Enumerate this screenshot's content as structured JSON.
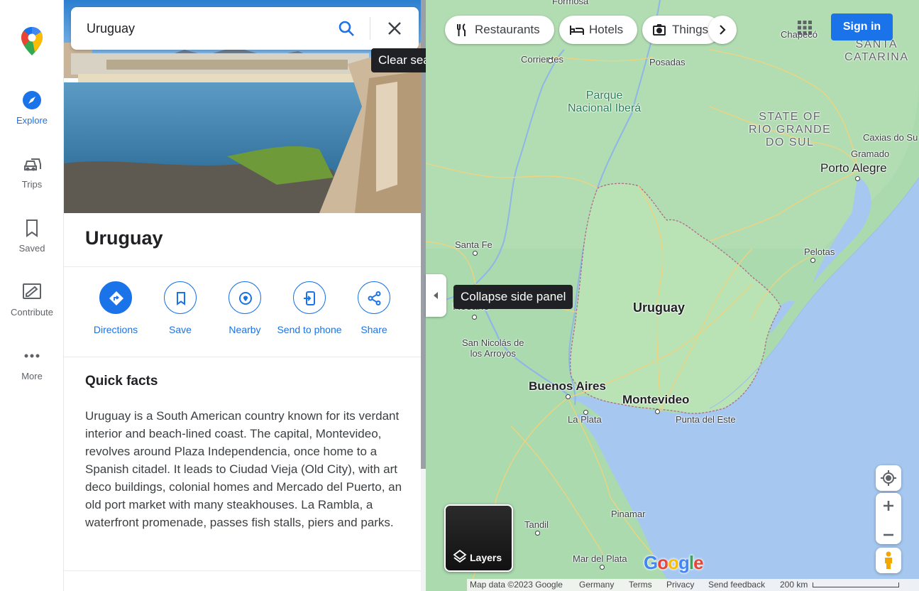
{
  "rail": {
    "items": [
      {
        "label": "Explore",
        "icon": "compass-icon"
      },
      {
        "label": "Trips",
        "icon": "car-icon"
      },
      {
        "label": "Saved",
        "icon": "bookmark-icon"
      },
      {
        "label": "Contribute",
        "icon": "edit-icon"
      },
      {
        "label": "More",
        "icon": "more-dots-icon"
      }
    ]
  },
  "search": {
    "value": "Uruguay",
    "clear_tooltip": "Clear search"
  },
  "place": {
    "title": "Uruguay",
    "actions": [
      {
        "label": "Directions",
        "icon": "directions-icon"
      },
      {
        "label": "Save",
        "icon": "bookmark-icon"
      },
      {
        "label": "Nearby",
        "icon": "nearby-icon"
      },
      {
        "label": "Send to phone",
        "icon": "phone-icon"
      },
      {
        "label": "Share",
        "icon": "share-icon"
      }
    ],
    "quick_facts_title": "Quick facts",
    "quick_facts_text": "Uruguay is a South American country known for its verdant interior and beach-lined coast. The capital, Montevideo, revolves around Plaza Independencia, once home to a Spanish citadel. It leads to Ciudad Vieja (Old City), with art deco buildings, colonial homes and Mercado del Puerto, an old port market with many steakhouses. La Rambla, a waterfront promenade, passes fish stalls, piers and parks."
  },
  "map": {
    "chips": [
      {
        "label": "Restaurants",
        "icon": "restaurant-icon"
      },
      {
        "label": "Hotels",
        "icon": "hotel-icon"
      },
      {
        "label": "Things to do",
        "icon": "camera-icon"
      }
    ],
    "sign_in": "Sign in",
    "collapse_tooltip": "Collapse side panel",
    "layers_label": "Layers",
    "labels": {
      "formosa": "Formosa",
      "corrientes": "Corrientes",
      "posadas": "Posadas",
      "chapeco": "Chapecó",
      "santa_catarina": "SANTA\nCATARINA",
      "park": "Parque\nNacional Iberá",
      "rio_grande": "STATE OF\nRIO GRANDE\nDO SUL",
      "caxias": "Caxias do Su",
      "gramado": "Gramado",
      "porto_alegre": "Porto Alegre",
      "santa_fe": "Santa Fe",
      "pelotas": "Pelotas",
      "rosario": "Rosario",
      "uruguay": "Uruguay",
      "san_nicolas": "San Nicolás de\nlos Arroyos",
      "buenos_aires": "Buenos Aires",
      "montevideo": "Montevideo",
      "la_plata": "La Plata",
      "punta_del_este": "Punta del Este",
      "pinamar": "Pinamar",
      "tandil": "Tandil",
      "mar_del_plata": "Mar del Plata"
    },
    "footer": {
      "map_data": "Map data ©2023 Google",
      "country": "Germany",
      "terms": "Terms",
      "privacy": "Privacy",
      "feedback": "Send feedback",
      "scale": "200 km"
    }
  }
}
